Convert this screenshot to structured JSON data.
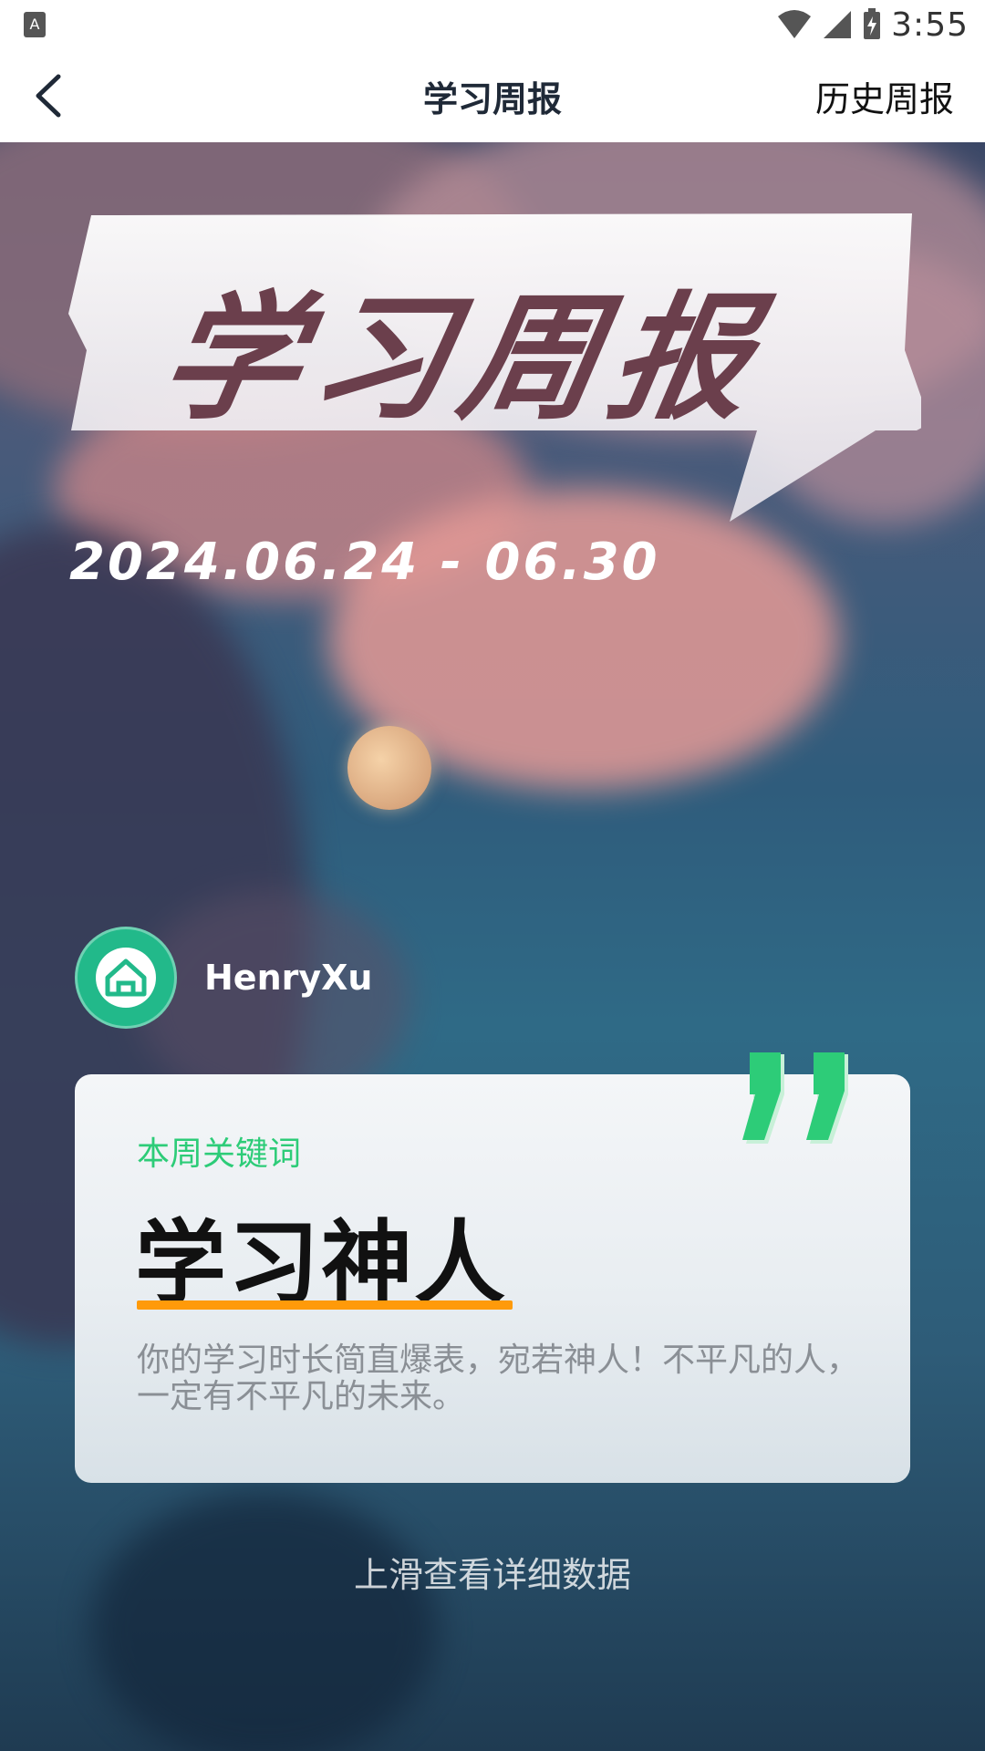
{
  "status_bar": {
    "left_icon": "A",
    "time": "3:55",
    "icons": [
      "wifi-icon",
      "signal-icon",
      "battery-charging-icon"
    ]
  },
  "header": {
    "title": "学习周报",
    "right_link": "历史周报",
    "back_icon": "chevron-left-icon"
  },
  "banner": {
    "title": "学习周报",
    "date_range": "2024.06.24 - 06.30"
  },
  "user": {
    "name": "HenryXu",
    "avatar_icon": "home-icon"
  },
  "keyword_card": {
    "label": "本周关键词",
    "keyword": "学习神人",
    "description": "你的学习时长简直爆表，宛若神人！不平凡的人，一定有不平凡的未来。",
    "accent_color": "#2dcc78",
    "underline_color": "#ff9a0a"
  },
  "scroll_hint": "上滑查看详细数据"
}
